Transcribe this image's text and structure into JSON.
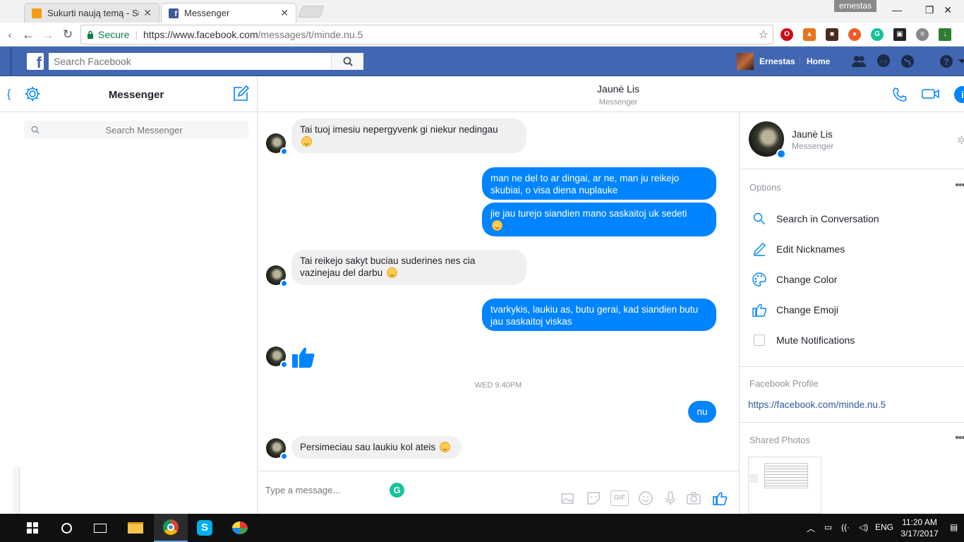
{
  "browser": {
    "tabs": [
      {
        "label": "Sukurti naują temą - Sup",
        "active": false
      },
      {
        "label": "Messenger",
        "active": true
      }
    ],
    "profile_name": "ernestas",
    "secure_label": "Secure",
    "url_base": "https://www.facebook.com",
    "url_path": "/messages/t/minde.nu.5"
  },
  "fb": {
    "search_placeholder": "Search Facebook",
    "user_name": "Ernestas",
    "home_label": "Home"
  },
  "messenger": {
    "title": "Messenger",
    "search_placeholder": "Search Messenger"
  },
  "conversation": {
    "contact_name": "Jaunė Lis",
    "contact_sub": "Messenger",
    "messages": [
      {
        "dir": "in",
        "text": "Tai tuoj imesiu nepergyvenk gi niekur nedingau"
      },
      {
        "dir": "out",
        "text": "man ne del to ar dingai, ar ne, man ju reikejo skubiai, o visa diena nuplauke"
      },
      {
        "dir": "out",
        "text": "jie jau turejo siandien mano saskaitoj uk sedeti"
      },
      {
        "dir": "in",
        "text": "Tai reikejo sakyt buciau suderines nes cia vazinejau del darbu"
      },
      {
        "dir": "out",
        "text": "tvarkykis, laukiu as, butu gerai, kad siandien butu jau saskaitoj viskas"
      },
      {
        "dir": "in",
        "text": "nu"
      },
      {
        "dir": "in",
        "text": "Persimeciau sau laukiu kol ateis"
      }
    ],
    "timestamp": "WED 9:40PM",
    "composer_placeholder": "Type a message..."
  },
  "info": {
    "name": "Jaunė Lis",
    "sub": "Messenger",
    "options_label": "Options",
    "options": [
      "Search in Conversation",
      "Edit Nicknames",
      "Change Color",
      "Change Emoji",
      "Mute Notifications"
    ],
    "profile_label": "Facebook Profile",
    "profile_url": "https://facebook.com/minde.nu.5",
    "photos_label": "Shared Photos"
  },
  "taskbar": {
    "lang": "ENG",
    "time": "11:20 AM",
    "date": "3/17/2017"
  },
  "colors": {
    "fb_blue": "#4267b2",
    "messenger_blue": "#0084ff",
    "bubble_gray": "#f1f0f0"
  }
}
